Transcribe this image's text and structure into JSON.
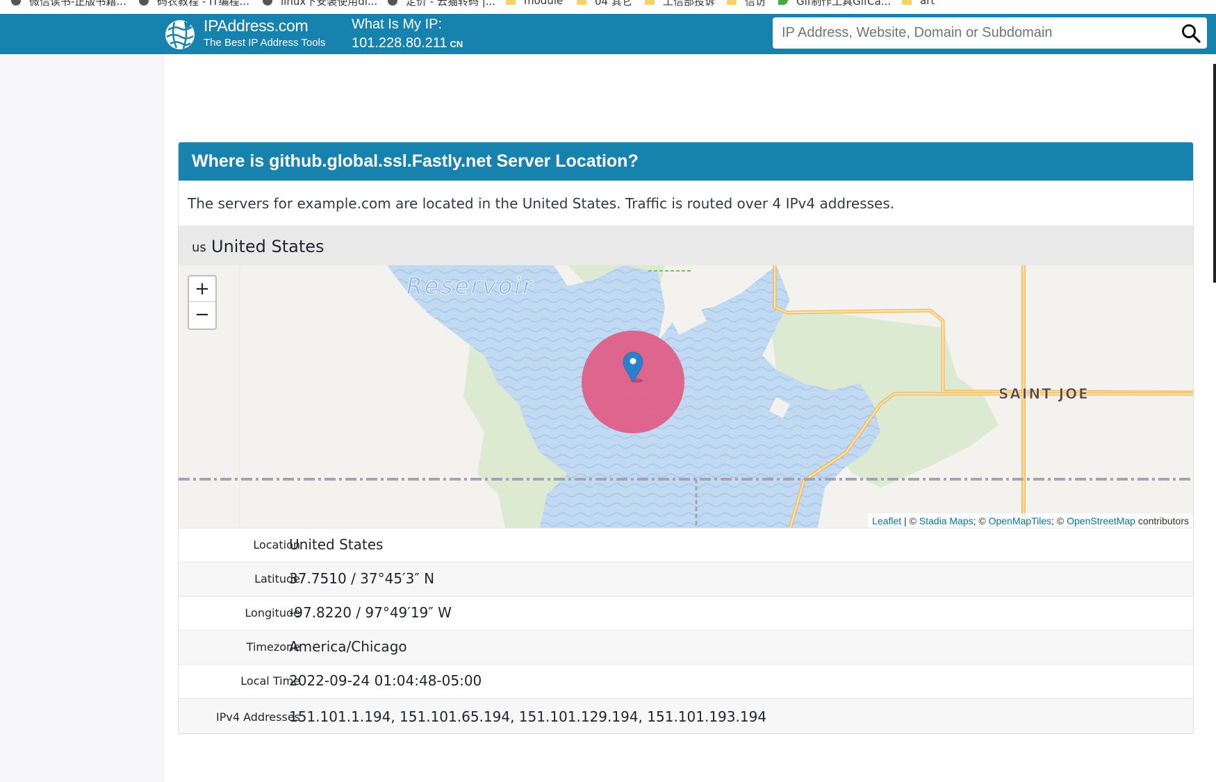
{
  "bookmarks": [
    {
      "label": "微信读书-正版书籍...",
      "icon": "globe-icon"
    },
    {
      "label": "码农教程 - IT编程...",
      "icon": "globe-icon"
    },
    {
      "label": "linux下安装使用di...",
      "icon": "globe-icon"
    },
    {
      "label": "定价 - 云猫转码 |...",
      "icon": "globe-icon"
    },
    {
      "label": "module",
      "icon": "folder-icon"
    },
    {
      "label": "04 其它",
      "icon": "folder-icon"
    },
    {
      "label": "工信部投诉",
      "icon": "folder-icon"
    },
    {
      "label": "信访",
      "icon": "folder-icon"
    },
    {
      "label": "Gif制作工具GifCa...",
      "icon": "leaf-icon"
    },
    {
      "label": "art",
      "icon": "folder-icon"
    }
  ],
  "header": {
    "brand_name": "IPAddress.com",
    "brand_tagline": "The Best IP Address Tools",
    "myip_label": "What Is My IP:",
    "myip_value": "101.228.80.211",
    "myip_country": "CN",
    "search_placeholder": "IP Address, Website, Domain or Subdomain",
    "accent_color": "#1782ae"
  },
  "card": {
    "title": "Where is github.global.ssl.Fastly.net Server Location?",
    "intro": "The servers for example.com are located in the United States. Traffic is routed over 4 IPv4 addresses.",
    "country_code": "us",
    "country_name": "United States"
  },
  "map": {
    "zoom_in": "+",
    "zoom_out": "−",
    "label_reservoir": "Reservoir",
    "label_town": "SAINT JOE",
    "attribution": {
      "leaflet": "Leaflet",
      "sep1": " | © ",
      "stadia": "Stadia Maps",
      "sep2": "; © ",
      "openmaptiles": "OpenMapTiles",
      "sep3": "; © ",
      "osm": "OpenStreetMap",
      "suffix": " contributors"
    },
    "marker_circle_color": "#e05b86",
    "water_color": "#c2d9f2",
    "park_color": "#dbead1"
  },
  "details": [
    {
      "label": "Location",
      "value": "United States"
    },
    {
      "label": "Latitude",
      "value": "37.7510 / 37°45′3″ N"
    },
    {
      "label": "Longitude",
      "value": "-97.8220 / 97°49′19″ W"
    },
    {
      "label": "Timezone",
      "value": "America/Chicago"
    },
    {
      "label": "Local Time",
      "value": "2022-09-24 01:04:48-05:00"
    },
    {
      "label": "IPv4 Addresses",
      "value": "151.101.1.194, 151.101.65.194, 151.101.129.194, 151.101.193.194"
    }
  ]
}
